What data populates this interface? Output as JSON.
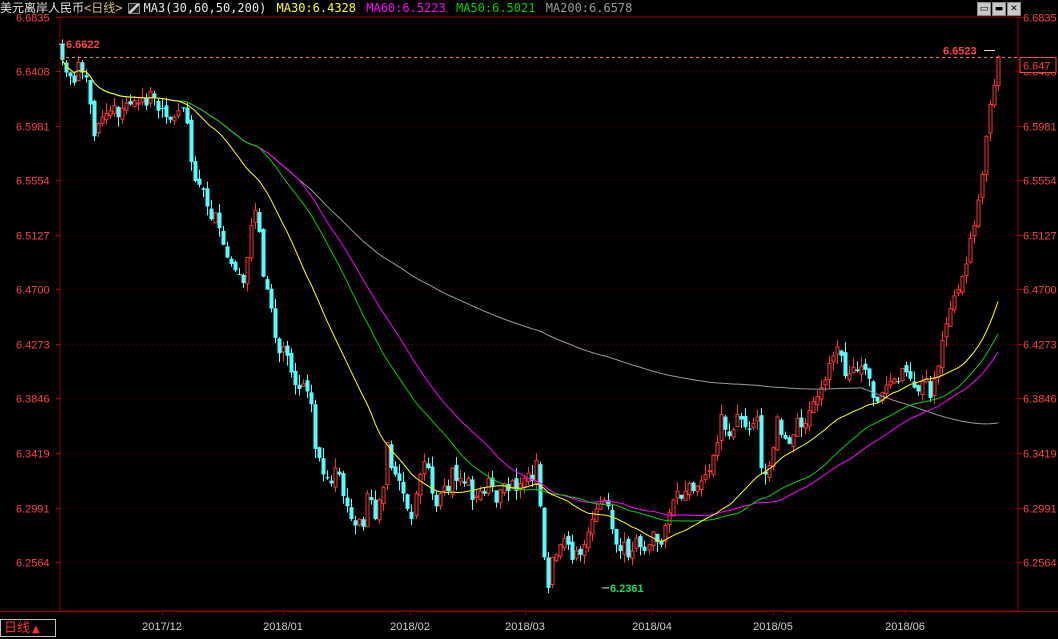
{
  "header": {
    "instrument": "美元离岸人民币",
    "period_tag": "<日线>",
    "ma3_label": "MA3(30,60,50,200)",
    "ma30_label": "MA30:6.4328",
    "ma60_label": "MA60:6.5223",
    "ma50_label": "MA50:6.5021",
    "ma200_label": "MA200:6.6578"
  },
  "window_buttons": [
    "restore-icon",
    "minimize-icon",
    "close-icon"
  ],
  "period_tab": {
    "label": "日线",
    "arrow": "▲"
  },
  "colors": {
    "background": "#000000",
    "up_candle": "#ff3232",
    "down_candle": "#54ffff",
    "ma30": "#ffff00",
    "ma50": "#00d000",
    "ma60": "#ff00ff",
    "ma200": "#9a9a9a",
    "axis_text": "#ff4040",
    "grid": "#7a0000",
    "reference_line": "#ff8040"
  },
  "chart_data": {
    "type": "candlestick",
    "y_ticks": [
      "6.6835",
      "6.6408",
      "6.5981",
      "6.5554",
      "6.5127",
      "6.4700",
      "6.4273",
      "6.3846",
      "6.3419",
      "6.2991",
      "6.2564"
    ],
    "ylim": [
      6.218,
      6.6835
    ],
    "x_labels": [
      "2017/12",
      "2018/01",
      "2018/02",
      "2018/03",
      "2018/04",
      "2018/05",
      "2018/06"
    ],
    "grid": true,
    "high_label": "6.6622",
    "low_label": "6.2361",
    "last_close_label": "6.6523",
    "current_price_label": "6.647",
    "ma_values": {
      "MA30": 6.4328,
      "MA60": 6.5223,
      "MA50": 6.5021,
      "MA200": 6.6578
    },
    "closes": [
      6.65,
      6.64,
      6.637,
      6.632,
      6.648,
      6.64,
      6.636,
      6.615,
      6.59,
      6.6,
      6.605,
      6.608,
      6.61,
      6.614,
      6.605,
      6.612,
      6.616,
      6.615,
      6.618,
      6.616,
      6.62,
      6.614,
      6.625,
      6.62,
      6.61,
      6.612,
      6.605,
      6.603,
      6.605,
      6.61,
      6.612,
      6.6,
      6.57,
      6.555,
      6.552,
      6.548,
      6.535,
      6.525,
      6.53,
      6.518,
      6.505,
      6.495,
      6.49,
      6.485,
      6.482,
      6.475,
      6.495,
      6.52,
      6.532,
      6.515,
      6.48,
      6.47,
      6.455,
      6.432,
      6.42,
      6.425,
      6.418,
      6.405,
      6.395,
      6.392,
      6.396,
      6.39,
      6.38,
      6.345,
      6.338,
      6.325,
      6.322,
      6.318,
      6.33,
      6.325,
      6.308,
      6.3,
      6.29,
      6.285,
      6.29,
      6.284,
      6.31,
      6.305,
      6.29,
      6.305,
      6.315,
      6.35,
      6.33,
      6.325,
      6.32,
      6.31,
      6.298,
      6.29,
      6.31,
      6.325,
      6.335,
      6.33,
      6.31,
      6.3,
      6.31,
      6.316,
      6.312,
      6.33,
      6.32,
      6.322,
      6.318,
      6.322,
      6.305,
      6.308,
      6.312,
      6.31,
      6.322,
      6.315,
      6.303,
      6.313,
      6.318,
      6.312,
      6.32,
      6.312,
      6.318,
      6.322,
      6.326,
      6.32,
      6.336,
      6.3,
      6.26,
      6.2361,
      6.26,
      6.262,
      6.27,
      6.275,
      6.27,
      6.258,
      6.265,
      6.262,
      6.27,
      6.28,
      6.29,
      6.298,
      6.302,
      6.305,
      6.3,
      6.282,
      6.27,
      6.265,
      6.272,
      6.26,
      6.265,
      6.275,
      6.268,
      6.265,
      6.27,
      6.28,
      6.272,
      6.27,
      6.285,
      6.295,
      6.305,
      6.312,
      6.306,
      6.312,
      6.318,
      6.312,
      6.316,
      6.32,
      6.325,
      6.328,
      6.34,
      6.35,
      6.372,
      6.36,
      6.355,
      6.36,
      6.372,
      6.368,
      6.362,
      6.36,
      6.365,
      6.37,
      6.33,
      6.325,
      6.332,
      6.346,
      6.37,
      6.356,
      6.353,
      6.349,
      6.356,
      6.369,
      6.362,
      6.365,
      6.375,
      6.382,
      6.386,
      6.393,
      6.399,
      6.412,
      6.418,
      6.425,
      6.418,
      6.402,
      6.404,
      6.409,
      6.406,
      6.41,
      6.407,
      6.4,
      6.385,
      6.382,
      6.389,
      6.395,
      6.398,
      6.4,
      6.398,
      6.408,
      6.405,
      6.4,
      6.393,
      6.39,
      6.398,
      6.4,
      6.385,
      6.4,
      6.41,
      6.43,
      6.443,
      6.455,
      6.465,
      6.47,
      6.48,
      6.49,
      6.51,
      6.52,
      6.54,
      6.56,
      6.59,
      6.615,
      6.63,
      6.6523
    ]
  }
}
